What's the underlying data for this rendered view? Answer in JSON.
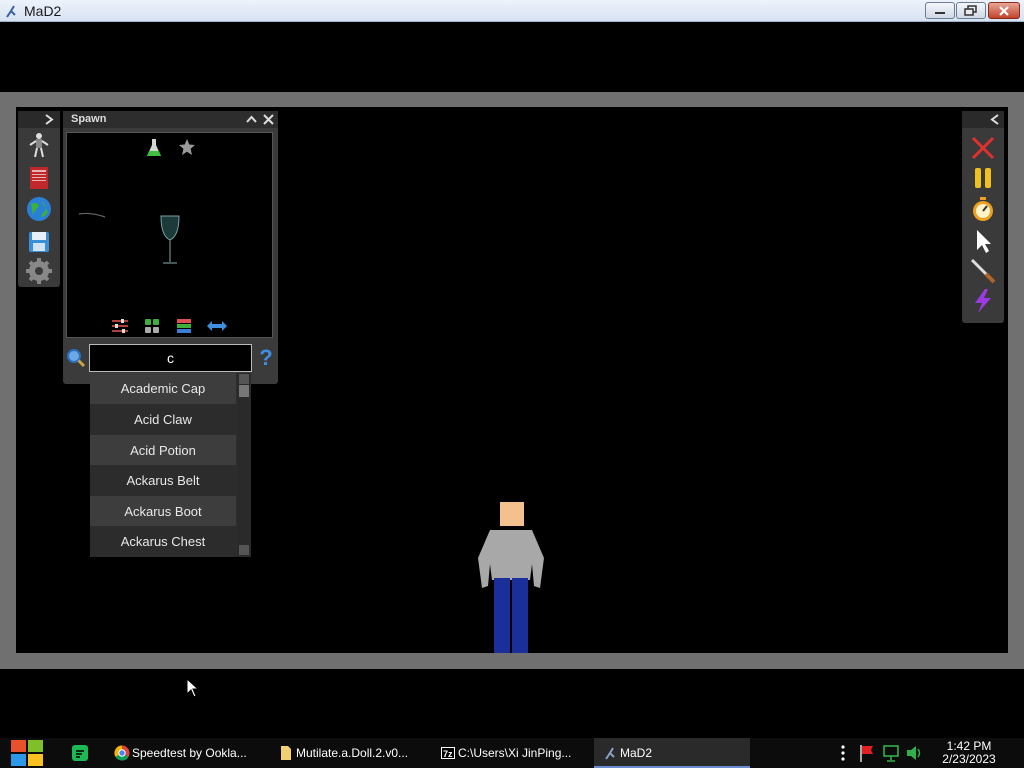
{
  "window": {
    "title": "MaD2",
    "controls": {
      "minimize": "minimize",
      "maximize": "maximize",
      "close": "close"
    }
  },
  "spawn_panel": {
    "title": "Spawn",
    "search": {
      "value": "c",
      "help": "?"
    },
    "results": [
      "Academic Cap",
      "Acid Claw",
      "Acid Potion",
      "Ackarus Belt",
      "Ackarus Boot",
      "Ackarus Chest"
    ],
    "top_icons": [
      "flask-icon",
      "star-icon"
    ],
    "bottom_icons": [
      "sliders-icon",
      "grid-icon",
      "list-icon",
      "swap-arrows-icon"
    ]
  },
  "left_toolbar": {
    "items": [
      "ragdoll-icon",
      "book-icon",
      "globe-icon",
      "save-icon",
      "settings-icon"
    ]
  },
  "right_toolbar": {
    "items": [
      "clear-icon",
      "pause-icon",
      "stopwatch-icon",
      "cursor-icon",
      "knife-icon",
      "lightning-icon"
    ]
  },
  "taskbar": {
    "tasks": [
      {
        "label": "Speedtest by Ookla...",
        "icon": "chrome-icon"
      },
      {
        "label": "Mutilate.a.Doll.2.v0...",
        "icon": "folder-icon"
      },
      {
        "label": "C:\\Users\\Xi JinPing...",
        "icon": "7zip-icon"
      },
      {
        "label": "MaD2",
        "icon": "mad2-icon"
      }
    ],
    "clock": {
      "time": "1:42 PM",
      "date": "2/23/2023"
    }
  },
  "colors": {
    "game_frame": "#707070",
    "panel": "#3b3b3b",
    "accent_red": "#e03030",
    "accent_yellow": "#f0c020",
    "accent_purple": "#9a3ae0"
  }
}
